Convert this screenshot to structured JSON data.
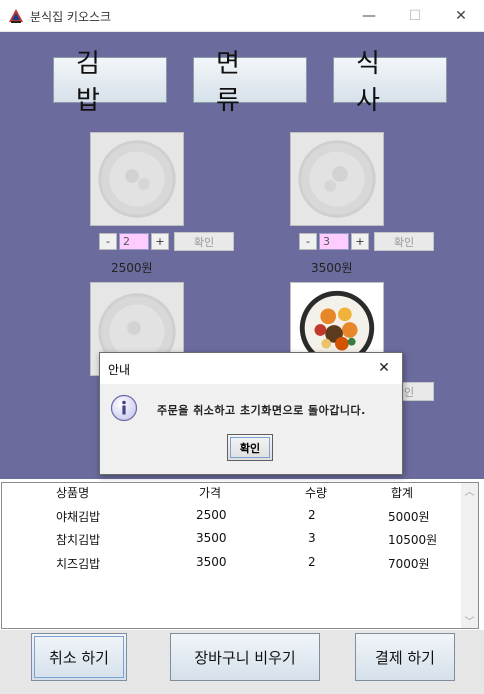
{
  "window": {
    "title": "분식집 키오스크",
    "minimize_glyph": "—",
    "maximize_glyph": "☐",
    "close_glyph": "✕"
  },
  "categories": [
    "김밥",
    "면류",
    "식사"
  ],
  "menu_items": [
    {
      "qty": "2",
      "price": "2500원",
      "ok_label": "확인",
      "minus": "-",
      "plus": "+",
      "enabled": false
    },
    {
      "qty": "3",
      "price": "3500원",
      "ok_label": "확인",
      "minus": "-",
      "plus": "+",
      "enabled": false
    },
    {
      "enabled": false
    },
    {
      "ok_label": "확인",
      "enabled": true
    }
  ],
  "dialog": {
    "title": "안내",
    "message": "주문을 취소하고 초기화면으로 돌아갑니다.",
    "ok_label": "확인",
    "close_glyph": "✕",
    "icon": "info-icon"
  },
  "order_table": {
    "headers": [
      "상품명",
      "가격",
      "수량",
      "합계"
    ],
    "rows": [
      [
        "야채김밥",
        "2500",
        "2",
        "5000원"
      ],
      [
        "참치김밥",
        "3500",
        "3",
        "10500원"
      ],
      [
        "치즈김밥",
        "3500",
        "2",
        "7000원"
      ]
    ],
    "scroll_up_glyph": "︿",
    "scroll_down_glyph": "﹀"
  },
  "bottom_buttons": {
    "cancel": "취소 하기",
    "empty_cart": "장바구니 비우기",
    "pay": "결제 하기"
  },
  "colors": {
    "panel_background": "#6b6b9e",
    "qty_field": "#ffccff"
  }
}
